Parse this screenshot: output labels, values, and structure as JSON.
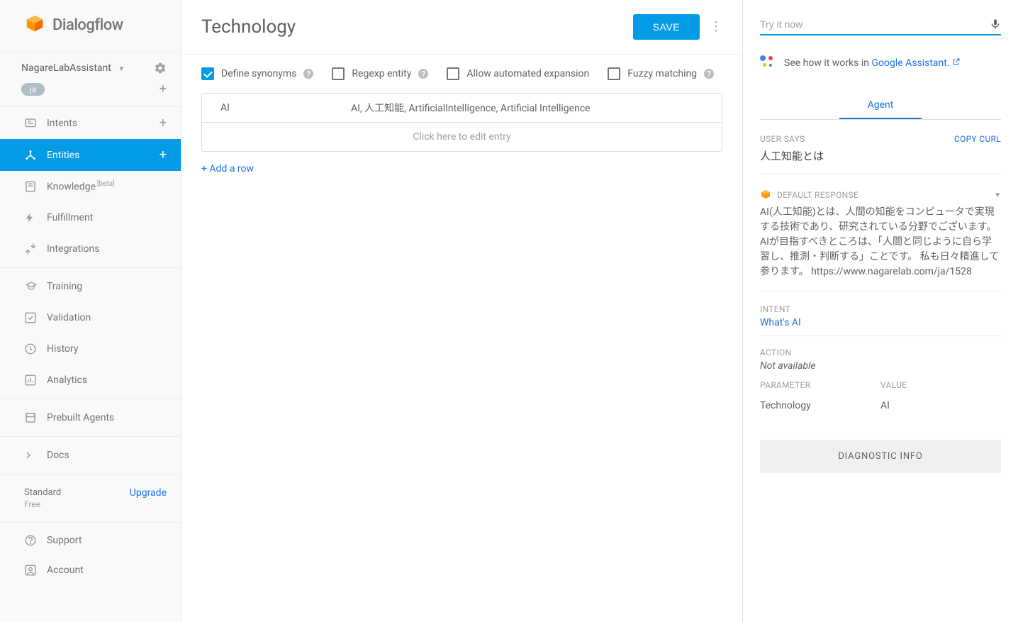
{
  "logo_text": "Dialogflow",
  "agent": {
    "name": "NagareLabAssistant",
    "lang": "ja"
  },
  "sidebar": {
    "intents": "Intents",
    "entities": "Entities",
    "knowledge": "Knowledge",
    "knowledge_badge": "[beta]",
    "fulfillment": "Fulfillment",
    "integrations": "Integrations",
    "training": "Training",
    "validation": "Validation",
    "history": "History",
    "analytics": "Analytics",
    "prebuilt": "Prebuilt Agents",
    "docs": "Docs",
    "plan": "Standard",
    "plan_sub": "Free",
    "upgrade": "Upgrade",
    "support": "Support",
    "account": "Account"
  },
  "page": {
    "title": "Technology",
    "save": "SAVE"
  },
  "options": {
    "synonyms": "Define synonyms",
    "regexp": "Regexp entity",
    "auto_expand": "Allow automated expansion",
    "fuzzy": "Fuzzy matching"
  },
  "entity_row": {
    "key": "AI",
    "synonyms": "AI, 人工知能, ArtificialIntelligence, Artificial Intelligence"
  },
  "edit_placeholder": "Click here to edit entry",
  "add_row": "+ Add a row",
  "try": {
    "placeholder": "Try it now",
    "howitworks_pre": "See how it works in ",
    "howitworks_link": "Google Assistant.",
    "tab_agent": "Agent",
    "user_says_label": "USER SAYS",
    "copy_curl": "COPY CURL",
    "user_says": "人工知能とは",
    "response_label": "DEFAULT RESPONSE",
    "response_text": "AI(人工知能)とは、人間の知能をコンピュータで実現する技術であり、研究されている分野でございます。 AIが目指すべきところは、「人間と同じように自ら学習し、推測・判断する」ことです。 私も日々精進して参ります。 https://www.nagarelab.com/ja/1528",
    "intent_label": "INTENT",
    "intent_value": "What's AI",
    "action_label": "ACTION",
    "action_value": "Not available",
    "parameter_label": "PARAMETER",
    "value_label": "VALUE",
    "param_name": "Technology",
    "param_value": "AI",
    "diagnostic": "DIAGNOSTIC INFO"
  }
}
